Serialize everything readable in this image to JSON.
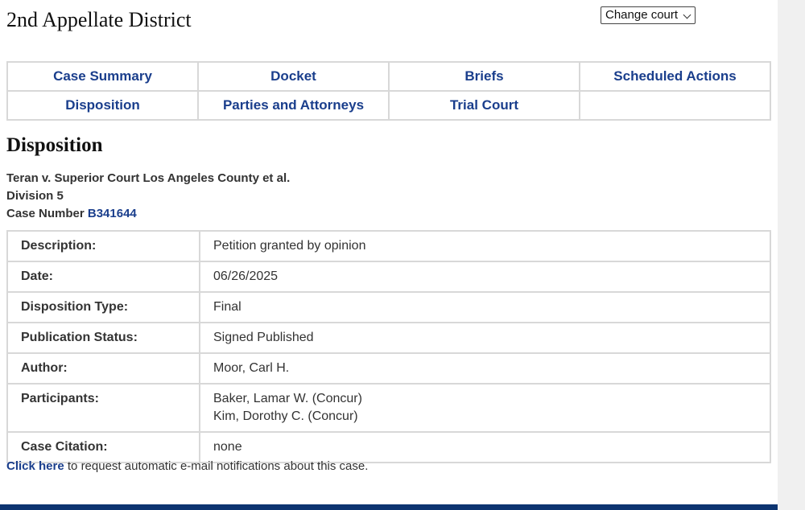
{
  "header": {
    "district": "2nd Appellate District",
    "change_court": "Change court"
  },
  "tabs": [
    [
      "Case Summary",
      "Docket",
      "Briefs",
      "Scheduled Actions"
    ],
    [
      "Disposition",
      "Parties and Attorneys",
      "Trial Court",
      ""
    ]
  ],
  "page_title": "Disposition",
  "case": {
    "title": "Teran v. Superior Court Los Angeles County et al.",
    "division": "Division 5",
    "number_label": "Case Number",
    "number": "B341644"
  },
  "details": [
    {
      "label": "Description:",
      "values": [
        "Petition granted by opinion"
      ]
    },
    {
      "label": "Date:",
      "values": [
        "06/26/2025"
      ]
    },
    {
      "label": "Disposition Type:",
      "values": [
        "Final"
      ]
    },
    {
      "label": "Publication Status:",
      "values": [
        "Signed Published"
      ]
    },
    {
      "label": "Author:",
      "values": [
        "Moor, Carl H."
      ]
    },
    {
      "label": "Participants:",
      "values": [
        "Baker, Lamar W. (Concur)",
        "Kim, Dorothy C. (Concur)"
      ]
    },
    {
      "label": "Case Citation:",
      "values": [
        "none"
      ]
    }
  ],
  "footer": {
    "link": "Click here",
    "text": " to request automatic e-mail notifications about this case."
  },
  "colors": {
    "link": "#1a3e8c",
    "bottom_bar": "#0d3470",
    "border": "#d8d8d8"
  }
}
